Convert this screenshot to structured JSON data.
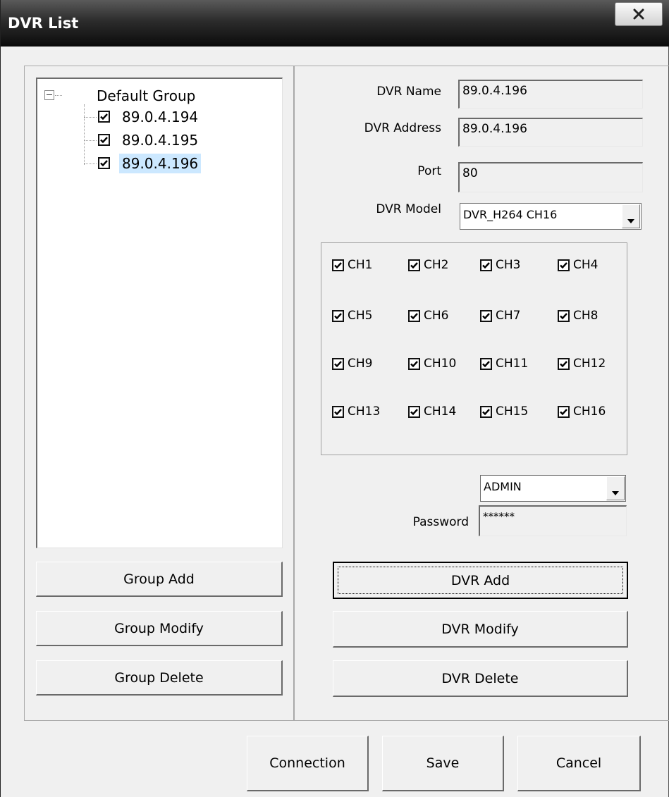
{
  "window": {
    "title": "DVR List",
    "close_symbol": "x"
  },
  "tree": {
    "root_label": "Default Group",
    "items": [
      {
        "label": "89.0.4.194",
        "checked": true,
        "selected": false
      },
      {
        "label": "89.0.4.195",
        "checked": true,
        "selected": false
      },
      {
        "label": "89.0.4.196",
        "checked": true,
        "selected": true
      }
    ]
  },
  "left_buttons": {
    "group_add": "Group Add",
    "group_modify": "Group Modify",
    "group_delete": "Group Delete"
  },
  "form": {
    "dvr_name_label": "DVR Name",
    "dvr_name_value": "89.0.4.196",
    "dvr_address_label": "DVR Address",
    "dvr_address_value": "89.0.4.196",
    "port_label": "Port",
    "port_value": "80",
    "dvr_model_label": "DVR Model",
    "dvr_model_value": "DVR_H264 CH16",
    "user_value": "ADMIN",
    "password_label": "Password",
    "password_value": "******"
  },
  "channels": [
    {
      "label": "CH1",
      "checked": true
    },
    {
      "label": "CH2",
      "checked": true
    },
    {
      "label": "CH3",
      "checked": true
    },
    {
      "label": "CH4",
      "checked": true
    },
    {
      "label": "CH5",
      "checked": true
    },
    {
      "label": "CH6",
      "checked": true
    },
    {
      "label": "CH7",
      "checked": true
    },
    {
      "label": "CH8",
      "checked": true
    },
    {
      "label": "CH9",
      "checked": true
    },
    {
      "label": "CH10",
      "checked": true
    },
    {
      "label": "CH11",
      "checked": true
    },
    {
      "label": "CH12",
      "checked": true
    },
    {
      "label": "CH13",
      "checked": true
    },
    {
      "label": "CH14",
      "checked": true
    },
    {
      "label": "CH15",
      "checked": true
    },
    {
      "label": "CH16",
      "checked": true
    }
  ],
  "right_buttons": {
    "dvr_add": "DVR Add",
    "dvr_modify": "DVR Modify",
    "dvr_delete": "DVR Delete"
  },
  "bottom_buttons": {
    "connection": "Connection",
    "save": "Save",
    "cancel": "Cancel"
  },
  "colors": {
    "selection_highlight": "#cce8ff",
    "title_bar": "#1e1e1e"
  }
}
